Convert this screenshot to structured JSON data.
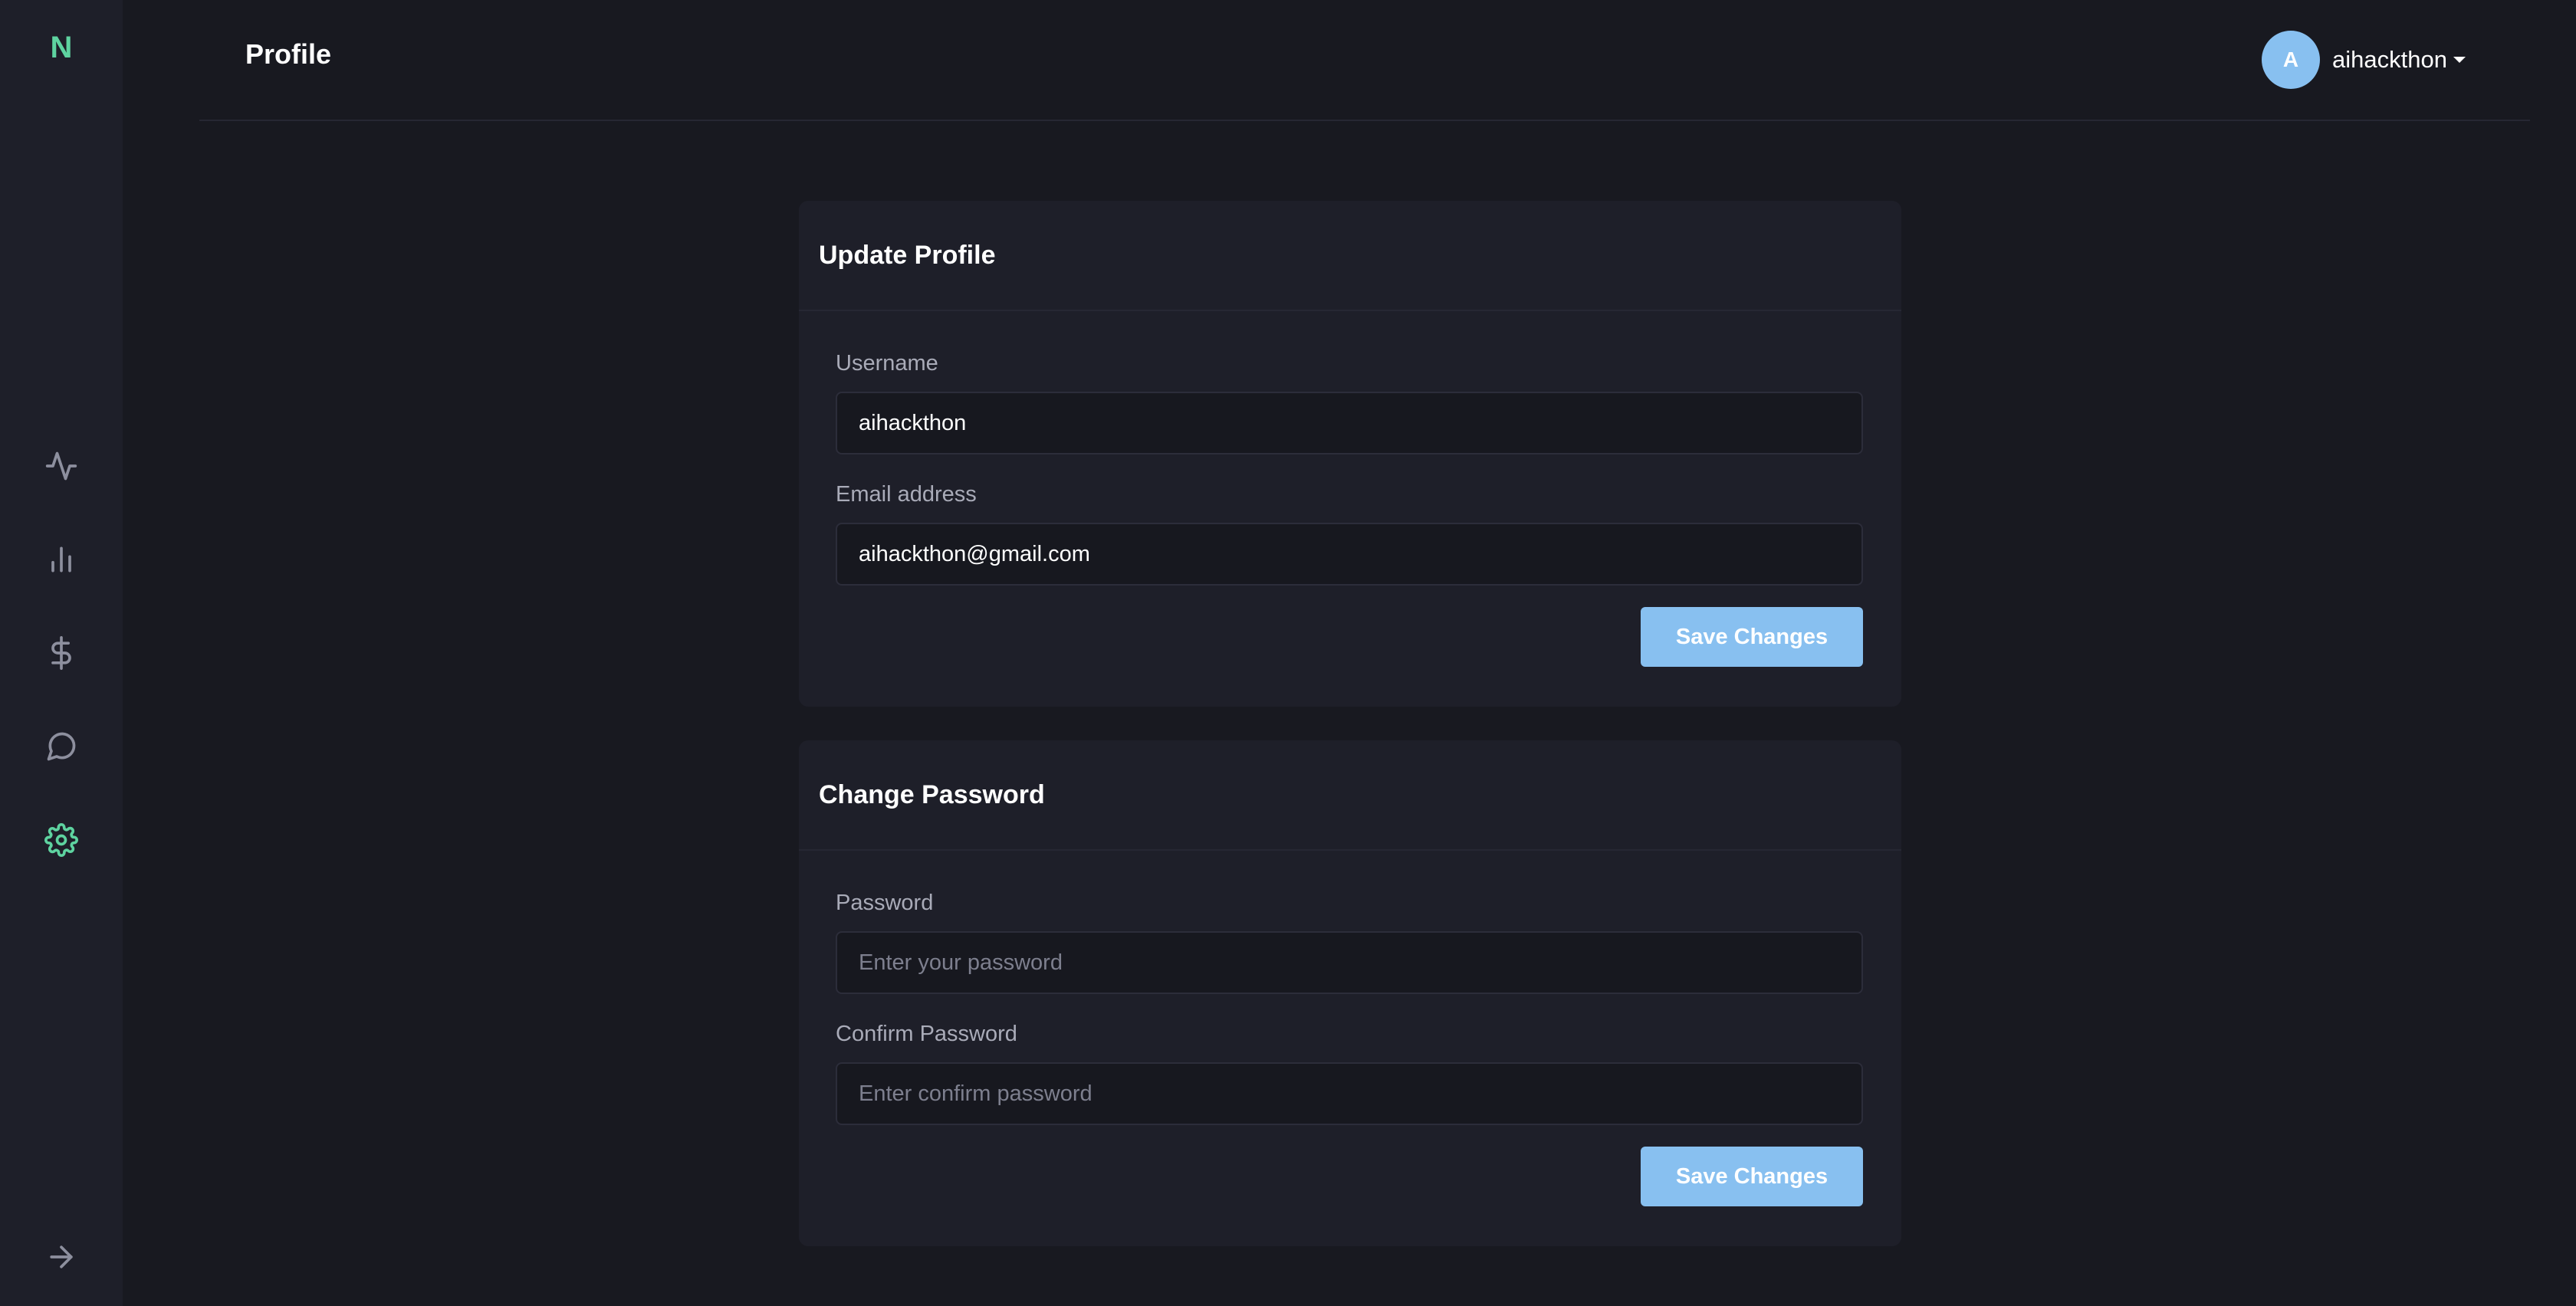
{
  "sidebar": {
    "logo": "N",
    "items": [
      {
        "icon": "activity-icon"
      },
      {
        "icon": "bar-chart-icon"
      },
      {
        "icon": "dollar-icon"
      },
      {
        "icon": "chat-icon"
      },
      {
        "icon": "gear-icon",
        "active": true
      }
    ],
    "bottom_icon": "arrow-right-icon"
  },
  "header": {
    "title": "Profile",
    "user": {
      "avatar_initial": "A",
      "name": "aihackthon"
    }
  },
  "update_profile": {
    "title": "Update Profile",
    "username_label": "Username",
    "username_value": "aihackthon",
    "email_label": "Email address",
    "email_value": "aihackthon@gmail.com",
    "save_label": "Save Changes"
  },
  "change_password": {
    "title": "Change Password",
    "password_label": "Password",
    "password_placeholder": "Enter your password",
    "confirm_label": "Confirm Password",
    "confirm_placeholder": "Enter confirm password",
    "save_label": "Save Changes"
  },
  "colors": {
    "accent": "#5ed3a0",
    "button": "#88c0f0",
    "background": "#181920",
    "panel": "#1e1f29"
  }
}
